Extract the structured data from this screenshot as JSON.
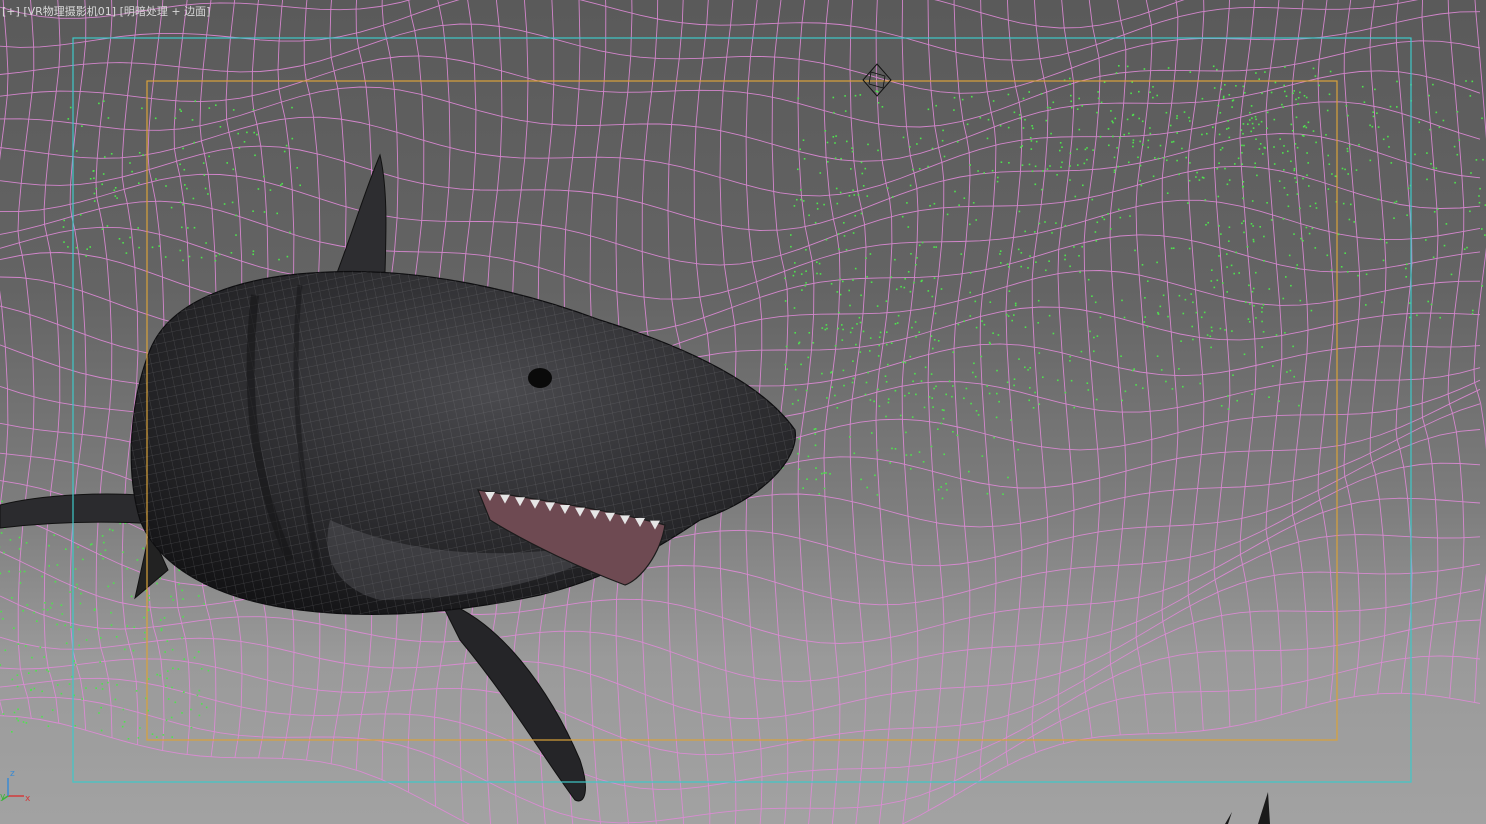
{
  "viewport": {
    "label_plus": "[+]",
    "label_camera": "[VR物理摄影机01]",
    "label_shading": "[明暗处理 + 边面]"
  },
  "axis_gizmo": {
    "x": "x",
    "y": "y",
    "z": "z"
  },
  "colors": {
    "safe_frame_outer": "#3ec9c9",
    "safe_frame_inner": "#d9a23a",
    "wireframe": "#e08ad8",
    "particles": "#4ee34e",
    "shark_body": "#2a2a2c"
  },
  "icons": {
    "target": "camera-target-icon"
  }
}
